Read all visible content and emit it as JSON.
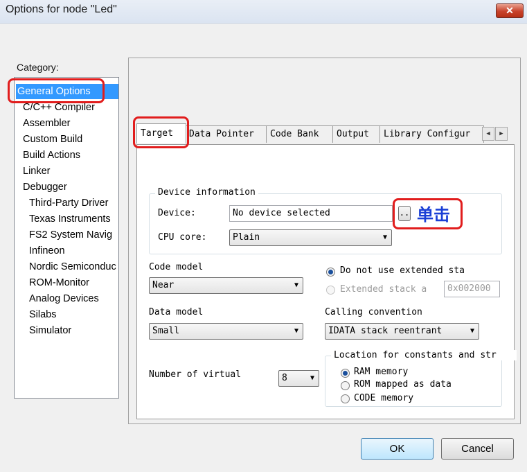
{
  "window": {
    "title": "Options for node \"Led\"",
    "close_glyph": "✕"
  },
  "category": {
    "label": "Category:",
    "items": [
      {
        "label": "General Options",
        "selected": true
      },
      {
        "label": "C/C++ Compiler"
      },
      {
        "label": "Assembler"
      },
      {
        "label": "Custom Build"
      },
      {
        "label": "Build Actions"
      },
      {
        "label": "Linker"
      },
      {
        "label": "Debugger"
      },
      {
        "label": "Third-Party Driver"
      },
      {
        "label": "Texas Instruments"
      },
      {
        "label": "FS2 System Navig"
      },
      {
        "label": "Infineon"
      },
      {
        "label": "Nordic Semiconduc"
      },
      {
        "label": "ROM-Monitor"
      },
      {
        "label": "Analog Devices"
      },
      {
        "label": "Silabs"
      },
      {
        "label": "Simulator"
      }
    ]
  },
  "tabs": [
    "Target",
    "Data Pointer",
    "Code Bank",
    "Output",
    "Library Configur"
  ],
  "tab_scroll": {
    "left_glyph": "◀",
    "right_glyph": "▶"
  },
  "device_info": {
    "group_title": "Device information",
    "device_label": "Device:",
    "device_value": "No device selected",
    "browse_label": "..",
    "annotation": "单击",
    "cpu_label": "CPU core:",
    "cpu_value": "Plain"
  },
  "code_model": {
    "label": "Code model",
    "value": "Near"
  },
  "stack": {
    "option1": "Do not use extended sta",
    "option2": "Extended stack a",
    "address": "0x002000",
    "selected": "option1"
  },
  "data_model": {
    "label": "Data model",
    "value": "Small"
  },
  "calling_convention": {
    "label": "Calling convention",
    "value": "IDATA stack reentrant"
  },
  "virtual_regs": {
    "label": "Number of virtual",
    "value": "8"
  },
  "constants": {
    "group_title": "Location for constants and str",
    "options": [
      "RAM memory",
      "ROM mapped as data",
      "CODE memory"
    ],
    "selected": 0
  },
  "buttons": {
    "ok": "OK",
    "cancel": "Cancel"
  },
  "colors": {
    "highlight": "#e11d1d",
    "annotation": "#1a3fd6",
    "selection": "#3399ff"
  }
}
